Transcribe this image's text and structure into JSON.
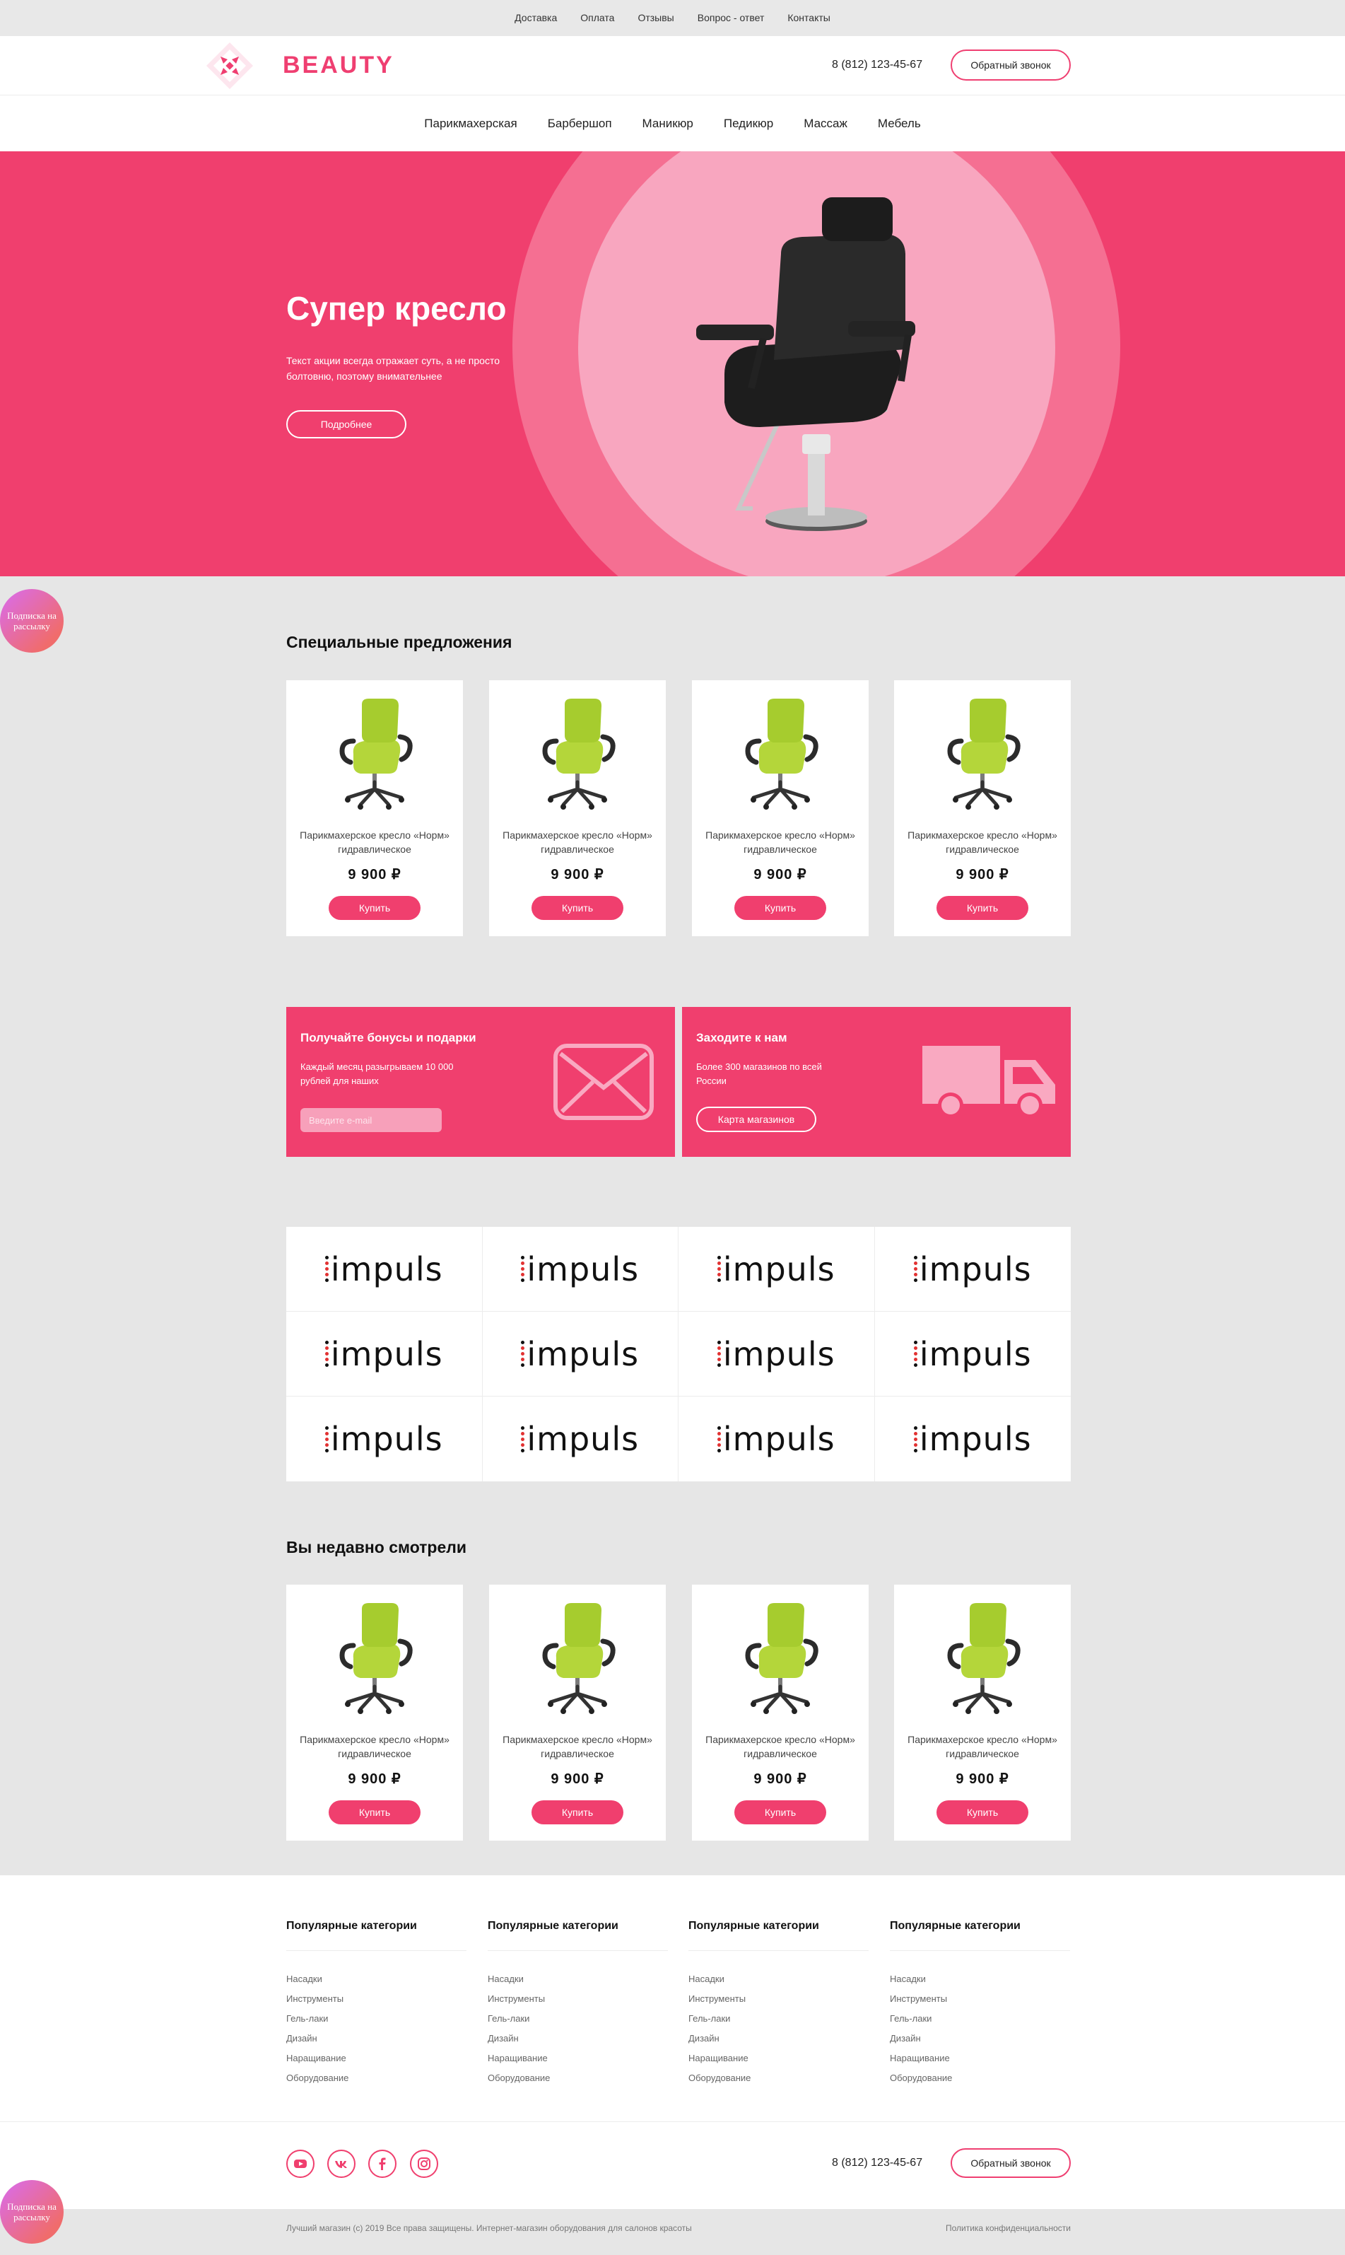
{
  "topbar": {
    "links": [
      "Доставка",
      "Оплата",
      "Отзывы",
      "Вопрос - ответ",
      "Контакты"
    ]
  },
  "header": {
    "logo_text": "BEAUTY",
    "phone": "8 (812) 123-45-67",
    "callback_label": "Обратный звонок"
  },
  "nav": {
    "items": [
      "Парикмахерская",
      "Барбершоп",
      "Маникюр",
      "Педикюр",
      "Массаж",
      "Мебель"
    ]
  },
  "hero": {
    "title": "Супер кресло",
    "text": "Текст акции всегда отражает суть, а не просто болтовню, поэтому внимательнее",
    "button": "Подробнее"
  },
  "subscribe_bubble": "Подписка на рассылку",
  "special": {
    "title": "Специальные предложения",
    "products": [
      {
        "name": "Парикмахерское кресло «Норм» гидравлическое",
        "price": "9 900 ₽",
        "buy": "Купить"
      },
      {
        "name": "Парикмахерское кресло «Норм» гидравлическое",
        "price": "9 900 ₽",
        "buy": "Купить"
      },
      {
        "name": "Парикмахерское кресло «Норм» гидравлическое",
        "price": "9 900 ₽",
        "buy": "Купить"
      },
      {
        "name": "Парикмахерское кресло «Норм» гидравлическое",
        "price": "9 900 ₽",
        "buy": "Купить"
      }
    ]
  },
  "promo": {
    "bonus": {
      "title": "Получайте бонусы и подарки",
      "text": "Каждый месяц разыгрываем 10 000 рублей для наших",
      "email_placeholder": "Введите e-mail"
    },
    "stores": {
      "title": "Заходите к нам",
      "text": "Более 300 магазинов по всей России",
      "button": "Карта магазинов"
    }
  },
  "brands": [
    "impuls",
    "impuls",
    "impuls",
    "impuls",
    "impuls",
    "impuls",
    "impuls",
    "impuls",
    "impuls",
    "impuls",
    "impuls",
    "impuls"
  ],
  "recent": {
    "title": "Вы недавно смотрели",
    "products": [
      {
        "name": "Парикмахерское кресло «Норм» гидравлическое",
        "price": "9 900 ₽",
        "buy": "Купить"
      },
      {
        "name": "Парикмахерское кресло «Норм» гидравлическое",
        "price": "9 900 ₽",
        "buy": "Купить"
      },
      {
        "name": "Парикмахерское кресло «Норм» гидравлическое",
        "price": "9 900 ₽",
        "buy": "Купить"
      },
      {
        "name": "Парикмахерское кресло «Норм» гидравлическое",
        "price": "9 900 ₽",
        "buy": "Купить"
      }
    ]
  },
  "footer": {
    "columns": [
      {
        "title": "Популярные категории",
        "links": [
          "Насадки",
          "Инструменты",
          "Гель-лаки",
          "Дизайн",
          "Наращивание",
          "Оборудование"
        ]
      },
      {
        "title": "Популярные категории",
        "links": [
          "Насадки",
          "Инструменты",
          "Гель-лаки",
          "Дизайн",
          "Наращивание",
          "Оборудование"
        ]
      },
      {
        "title": "Популярные категории",
        "links": [
          "Насадки",
          "Инструменты",
          "Гель-лаки",
          "Дизайн",
          "Наращивание",
          "Оборудование"
        ]
      },
      {
        "title": "Популярные категории",
        "links": [
          "Насадки",
          "Инструменты",
          "Гель-лаки",
          "Дизайн",
          "Наращивание",
          "Оборудование"
        ]
      }
    ],
    "social_icons": [
      "youtube-icon",
      "vk-icon",
      "facebook-icon",
      "instagram-icon"
    ],
    "phone": "8 (812) 123-45-67",
    "callback_label": "Обратный звонок",
    "copyright": "Лучший магазин (с) 2019 Все права защищены. Интернет-магазин оборудования для салонов красоты",
    "policy": "Политика конфиденциальности"
  },
  "colors": {
    "accent": "#f03f6e",
    "hero_ring": "#f56f92",
    "hero_circle": "#f8a6bf",
    "page_bg": "#e6e6e6"
  }
}
